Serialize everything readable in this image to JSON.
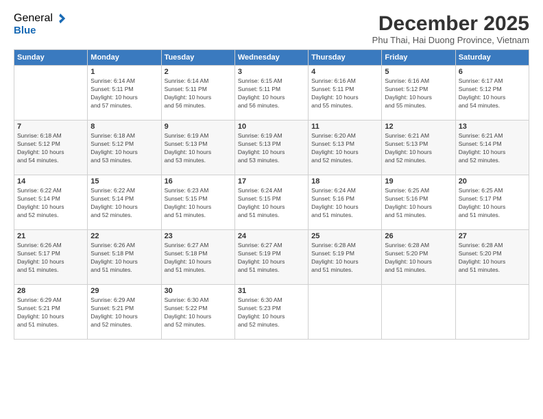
{
  "logo": {
    "general": "General",
    "blue": "Blue"
  },
  "title": "December 2025",
  "subtitle": "Phu Thai, Hai Duong Province, Vietnam",
  "days_of_week": [
    "Sunday",
    "Monday",
    "Tuesday",
    "Wednesday",
    "Thursday",
    "Friday",
    "Saturday"
  ],
  "weeks": [
    [
      {
        "day": "",
        "info": ""
      },
      {
        "day": "1",
        "info": "Sunrise: 6:14 AM\nSunset: 5:11 PM\nDaylight: 10 hours\nand 57 minutes."
      },
      {
        "day": "2",
        "info": "Sunrise: 6:14 AM\nSunset: 5:11 PM\nDaylight: 10 hours\nand 56 minutes."
      },
      {
        "day": "3",
        "info": "Sunrise: 6:15 AM\nSunset: 5:11 PM\nDaylight: 10 hours\nand 56 minutes."
      },
      {
        "day": "4",
        "info": "Sunrise: 6:16 AM\nSunset: 5:11 PM\nDaylight: 10 hours\nand 55 minutes."
      },
      {
        "day": "5",
        "info": "Sunrise: 6:16 AM\nSunset: 5:12 PM\nDaylight: 10 hours\nand 55 minutes."
      },
      {
        "day": "6",
        "info": "Sunrise: 6:17 AM\nSunset: 5:12 PM\nDaylight: 10 hours\nand 54 minutes."
      }
    ],
    [
      {
        "day": "7",
        "info": "Sunrise: 6:18 AM\nSunset: 5:12 PM\nDaylight: 10 hours\nand 54 minutes."
      },
      {
        "day": "8",
        "info": "Sunrise: 6:18 AM\nSunset: 5:12 PM\nDaylight: 10 hours\nand 53 minutes."
      },
      {
        "day": "9",
        "info": "Sunrise: 6:19 AM\nSunset: 5:13 PM\nDaylight: 10 hours\nand 53 minutes."
      },
      {
        "day": "10",
        "info": "Sunrise: 6:19 AM\nSunset: 5:13 PM\nDaylight: 10 hours\nand 53 minutes."
      },
      {
        "day": "11",
        "info": "Sunrise: 6:20 AM\nSunset: 5:13 PM\nDaylight: 10 hours\nand 52 minutes."
      },
      {
        "day": "12",
        "info": "Sunrise: 6:21 AM\nSunset: 5:13 PM\nDaylight: 10 hours\nand 52 minutes."
      },
      {
        "day": "13",
        "info": "Sunrise: 6:21 AM\nSunset: 5:14 PM\nDaylight: 10 hours\nand 52 minutes."
      }
    ],
    [
      {
        "day": "14",
        "info": "Sunrise: 6:22 AM\nSunset: 5:14 PM\nDaylight: 10 hours\nand 52 minutes."
      },
      {
        "day": "15",
        "info": "Sunrise: 6:22 AM\nSunset: 5:14 PM\nDaylight: 10 hours\nand 52 minutes."
      },
      {
        "day": "16",
        "info": "Sunrise: 6:23 AM\nSunset: 5:15 PM\nDaylight: 10 hours\nand 51 minutes."
      },
      {
        "day": "17",
        "info": "Sunrise: 6:24 AM\nSunset: 5:15 PM\nDaylight: 10 hours\nand 51 minutes."
      },
      {
        "day": "18",
        "info": "Sunrise: 6:24 AM\nSunset: 5:16 PM\nDaylight: 10 hours\nand 51 minutes."
      },
      {
        "day": "19",
        "info": "Sunrise: 6:25 AM\nSunset: 5:16 PM\nDaylight: 10 hours\nand 51 minutes."
      },
      {
        "day": "20",
        "info": "Sunrise: 6:25 AM\nSunset: 5:17 PM\nDaylight: 10 hours\nand 51 minutes."
      }
    ],
    [
      {
        "day": "21",
        "info": "Sunrise: 6:26 AM\nSunset: 5:17 PM\nDaylight: 10 hours\nand 51 minutes."
      },
      {
        "day": "22",
        "info": "Sunrise: 6:26 AM\nSunset: 5:18 PM\nDaylight: 10 hours\nand 51 minutes."
      },
      {
        "day": "23",
        "info": "Sunrise: 6:27 AM\nSunset: 5:18 PM\nDaylight: 10 hours\nand 51 minutes."
      },
      {
        "day": "24",
        "info": "Sunrise: 6:27 AM\nSunset: 5:19 PM\nDaylight: 10 hours\nand 51 minutes."
      },
      {
        "day": "25",
        "info": "Sunrise: 6:28 AM\nSunset: 5:19 PM\nDaylight: 10 hours\nand 51 minutes."
      },
      {
        "day": "26",
        "info": "Sunrise: 6:28 AM\nSunset: 5:20 PM\nDaylight: 10 hours\nand 51 minutes."
      },
      {
        "day": "27",
        "info": "Sunrise: 6:28 AM\nSunset: 5:20 PM\nDaylight: 10 hours\nand 51 minutes."
      }
    ],
    [
      {
        "day": "28",
        "info": "Sunrise: 6:29 AM\nSunset: 5:21 PM\nDaylight: 10 hours\nand 51 minutes."
      },
      {
        "day": "29",
        "info": "Sunrise: 6:29 AM\nSunset: 5:21 PM\nDaylight: 10 hours\nand 52 minutes."
      },
      {
        "day": "30",
        "info": "Sunrise: 6:30 AM\nSunset: 5:22 PM\nDaylight: 10 hours\nand 52 minutes."
      },
      {
        "day": "31",
        "info": "Sunrise: 6:30 AM\nSunset: 5:23 PM\nDaylight: 10 hours\nand 52 minutes."
      },
      {
        "day": "",
        "info": ""
      },
      {
        "day": "",
        "info": ""
      },
      {
        "day": "",
        "info": ""
      }
    ]
  ]
}
